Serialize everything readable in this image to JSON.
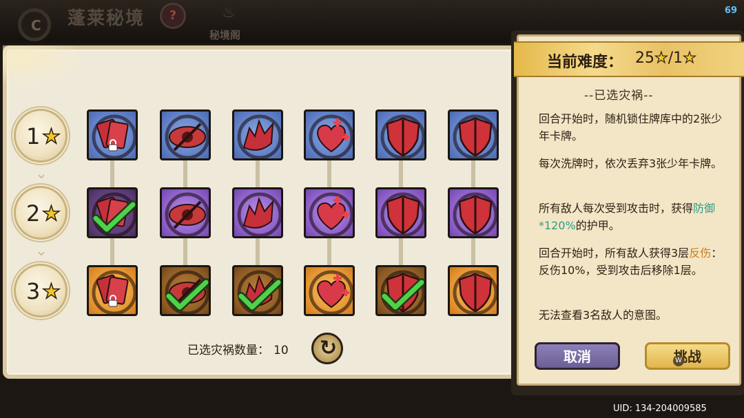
{
  "header": {
    "title": "蓬莱秘境",
    "help_glyph": "?",
    "sub_label": "秘境阁",
    "fps": "69"
  },
  "rows": [
    {
      "level": "1",
      "tiles": [
        {
          "color": "blue",
          "icon": "cards-icon",
          "state": "locked"
        },
        {
          "color": "blue",
          "icon": "eye-crossed-icon",
          "state": "normal"
        },
        {
          "color": "blue",
          "icon": "spiky-shell-icon",
          "state": "normal"
        },
        {
          "color": "blue",
          "icon": "heart-plus-icon",
          "state": "normal"
        },
        {
          "color": "blue",
          "icon": "shield-icon",
          "state": "normal"
        },
        {
          "color": "blue",
          "icon": "shield-icon",
          "state": "normal"
        }
      ]
    },
    {
      "level": "2",
      "tiles": [
        {
          "color": "purple-dark",
          "icon": "cards-icon",
          "state": "selected"
        },
        {
          "color": "purple",
          "icon": "eye-crossed-icon",
          "state": "normal"
        },
        {
          "color": "purple",
          "icon": "spiky-shell-icon",
          "state": "normal"
        },
        {
          "color": "purple",
          "icon": "heart-plus-icon",
          "state": "normal"
        },
        {
          "color": "purple",
          "icon": "shield-icon",
          "state": "normal"
        },
        {
          "color": "purple",
          "icon": "shield-icon",
          "state": "normal"
        }
      ]
    },
    {
      "level": "3",
      "tiles": [
        {
          "color": "orange",
          "icon": "cards-icon",
          "state": "locked"
        },
        {
          "color": "orange-dark",
          "icon": "eye-crossed-icon",
          "state": "selected"
        },
        {
          "color": "orange-dark",
          "icon": "spiky-shell-icon",
          "state": "selected"
        },
        {
          "color": "orange",
          "icon": "heart-plus-icon",
          "state": "normal"
        },
        {
          "color": "orange-dark",
          "icon": "shield-icon",
          "state": "selected"
        },
        {
          "color": "orange",
          "icon": "shield-icon",
          "state": "normal"
        }
      ]
    }
  ],
  "selected_count_label": "已选灾祸数量：",
  "selected_count": "10",
  "difficulty": {
    "label": "当前难度：",
    "current": "25",
    "separator": "/",
    "base": "1"
  },
  "picked_title": "--已选灾祸--",
  "descriptions": {
    "d1": "回合开始时，随机锁住牌库中的2张少年卡牌。",
    "d2": "每次洗牌时，依次丢弃3张少年卡牌。",
    "d3_a": "所有敌人每次受到攻击时，获得",
    "d3_hl": "防御*120%",
    "d3_b": "的护甲。",
    "d4_a": "回合开始时，所有敌人获得3层",
    "d4_hl": "反伤",
    "d4_b": "：反伤10%，受到攻击后移除1层。",
    "d5": "无法查看3名敌人的意图。"
  },
  "buttons": {
    "cancel": "取消",
    "challenge": "挑战",
    "cursor": "W"
  },
  "uid": "UID: 134-204009585",
  "colors": {
    "highlight_teal": "#2b9e86",
    "highlight_orange": "#c97b1c",
    "star_gold": "#f5c623"
  }
}
